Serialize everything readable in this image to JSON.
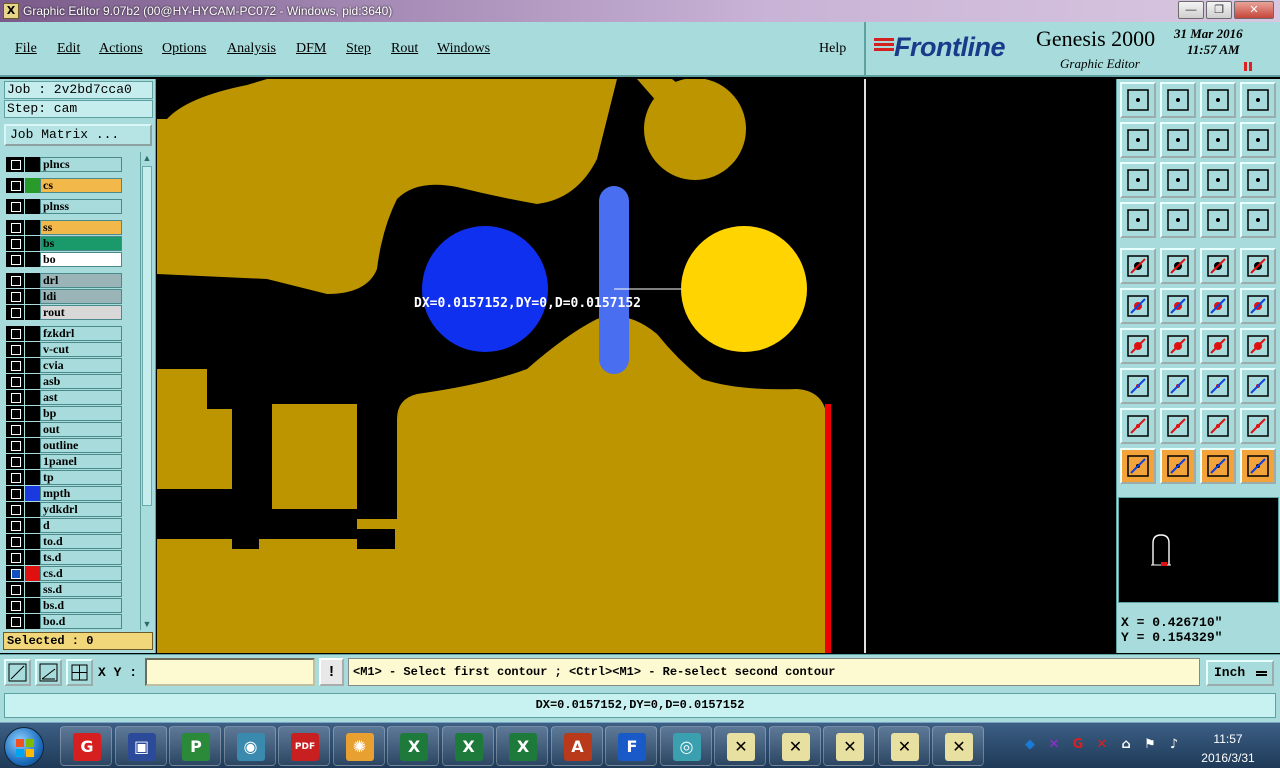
{
  "window": {
    "title": "Graphic Editor 9.07b2 (00@HY-HYCAM-PC072 - Windows, pid:3640)",
    "app_icon": "X",
    "controls": {
      "minimize": "—",
      "maximize": "❐",
      "close": "✕"
    }
  },
  "menu": {
    "items": [
      {
        "label": "File"
      },
      {
        "label": "Edit"
      },
      {
        "label": "Actions"
      },
      {
        "label": "Options"
      },
      {
        "label": "Analysis"
      },
      {
        "label": "DFM"
      },
      {
        "label": "Step"
      },
      {
        "label": "Rout"
      },
      {
        "label": "Windows"
      },
      {
        "label": "Help"
      }
    ]
  },
  "brand": {
    "logo": "Frontline",
    "product": "Genesis 2000",
    "subtitle": "Graphic Editor",
    "date": "31 Mar 2016",
    "time": "11:57 AM"
  },
  "job": {
    "job_line": "Job : 2v2bd7cca0",
    "step_line": "Step: cam",
    "matrix_button": "Job Matrix ..."
  },
  "layers": [
    {
      "name": "plncs",
      "color": "#a8dcdc",
      "swatch": "#000000",
      "active": false
    },
    {
      "name": "cs",
      "color": "#f2b84a",
      "swatch": "#2a9a2a",
      "active": false
    },
    {
      "name": "plnss",
      "color": "#a8dcdc",
      "swatch": "#000000",
      "active": false
    },
    {
      "name": "ss",
      "color": "#f2b84a",
      "swatch": "#000000",
      "active": false
    },
    {
      "name": "bs",
      "color": "#1a9a6a",
      "swatch": "#000000",
      "active": false
    },
    {
      "name": "bo",
      "color": "#ffffff",
      "swatch": "#000000",
      "active": false
    },
    {
      "name": "drl",
      "color": "#9ab4b8",
      "swatch": "#000000",
      "active": false
    },
    {
      "name": "ldi",
      "color": "#9ab4b8",
      "swatch": "#000000",
      "active": false
    },
    {
      "name": "rout",
      "color": "#d8d8d8",
      "swatch": "#000000",
      "active": false
    },
    {
      "name": "fzkdrl",
      "color": "#a8dcdc",
      "swatch": "#000000",
      "active": false
    },
    {
      "name": "v-cut",
      "color": "#a8dcdc",
      "swatch": "#000000",
      "active": false
    },
    {
      "name": "cvia",
      "color": "#a8dcdc",
      "swatch": "#000000",
      "active": false
    },
    {
      "name": "asb",
      "color": "#a8dcdc",
      "swatch": "#000000",
      "active": false
    },
    {
      "name": "ast",
      "color": "#a8dcdc",
      "swatch": "#000000",
      "active": false
    },
    {
      "name": "bp",
      "color": "#a8dcdc",
      "swatch": "#000000",
      "active": false
    },
    {
      "name": "out",
      "color": "#a8dcdc",
      "swatch": "#000000",
      "active": false
    },
    {
      "name": "outline",
      "color": "#a8dcdc",
      "swatch": "#000000",
      "active": false
    },
    {
      "name": "1panel",
      "color": "#a8dcdc",
      "swatch": "#000000",
      "active": false
    },
    {
      "name": "tp",
      "color": "#a8dcdc",
      "swatch": "#000000",
      "active": false
    },
    {
      "name": "mpth",
      "color": "#a8dcdc",
      "swatch": "#1a3ae0",
      "active": false
    },
    {
      "name": "ydkdrl",
      "color": "#a8dcdc",
      "swatch": "#000000",
      "active": false
    },
    {
      "name": "d",
      "color": "#a8dcdc",
      "swatch": "#000000",
      "active": false
    },
    {
      "name": "to.d",
      "color": "#a8dcdc",
      "swatch": "#000000",
      "active": false
    },
    {
      "name": "ts.d",
      "color": "#a8dcdc",
      "swatch": "#000000",
      "active": false
    },
    {
      "name": "cs.d",
      "color": "#a8dcdc",
      "swatch": "#e01010",
      "active": true
    },
    {
      "name": "ss.d",
      "color": "#a8dcdc",
      "swatch": "#000000",
      "active": false
    },
    {
      "name": "bs.d",
      "color": "#a8dcdc",
      "swatch": "#000000",
      "active": false
    },
    {
      "name": "bo.d",
      "color": "#a8dcdc",
      "swatch": "#000000",
      "active": false
    }
  ],
  "selected_label": "Selected : 0",
  "measurement": "DX=0.0157152,DY=0,D=0.0157152",
  "colors": {
    "copper": "#bc9500",
    "blue_pad": "#1030f0",
    "yellow_pad": "#ffd400",
    "slot": "#4a6ef0",
    "panel": "#a8dcdc"
  },
  "cursor_coords": {
    "x": "X = 0.426710\"",
    "y": "Y = 0.154329\""
  },
  "command": {
    "xy_label": "X Y :",
    "xy_value": "",
    "alert": "!",
    "prompt": "<M1> - Select first contour ; <Ctrl><M1> - Re-select second contour",
    "unit": "Inch"
  },
  "status": "DX=0.0157152,DY=0,D=0.0157152",
  "taskbar": {
    "apps": [
      "genesis-launcher",
      "save",
      "pads",
      "viewer",
      "pdf",
      "shell",
      "excel-1",
      "excel-2",
      "excel-3",
      "access",
      "frontline",
      "cam-tool",
      "graphic-editor-1",
      "graphic-editor-2",
      "graphic-editor-3",
      "graphic-editor-4",
      "graphic-editor-5"
    ],
    "clock_time": "11:57",
    "clock_date": "2016/3/31"
  }
}
